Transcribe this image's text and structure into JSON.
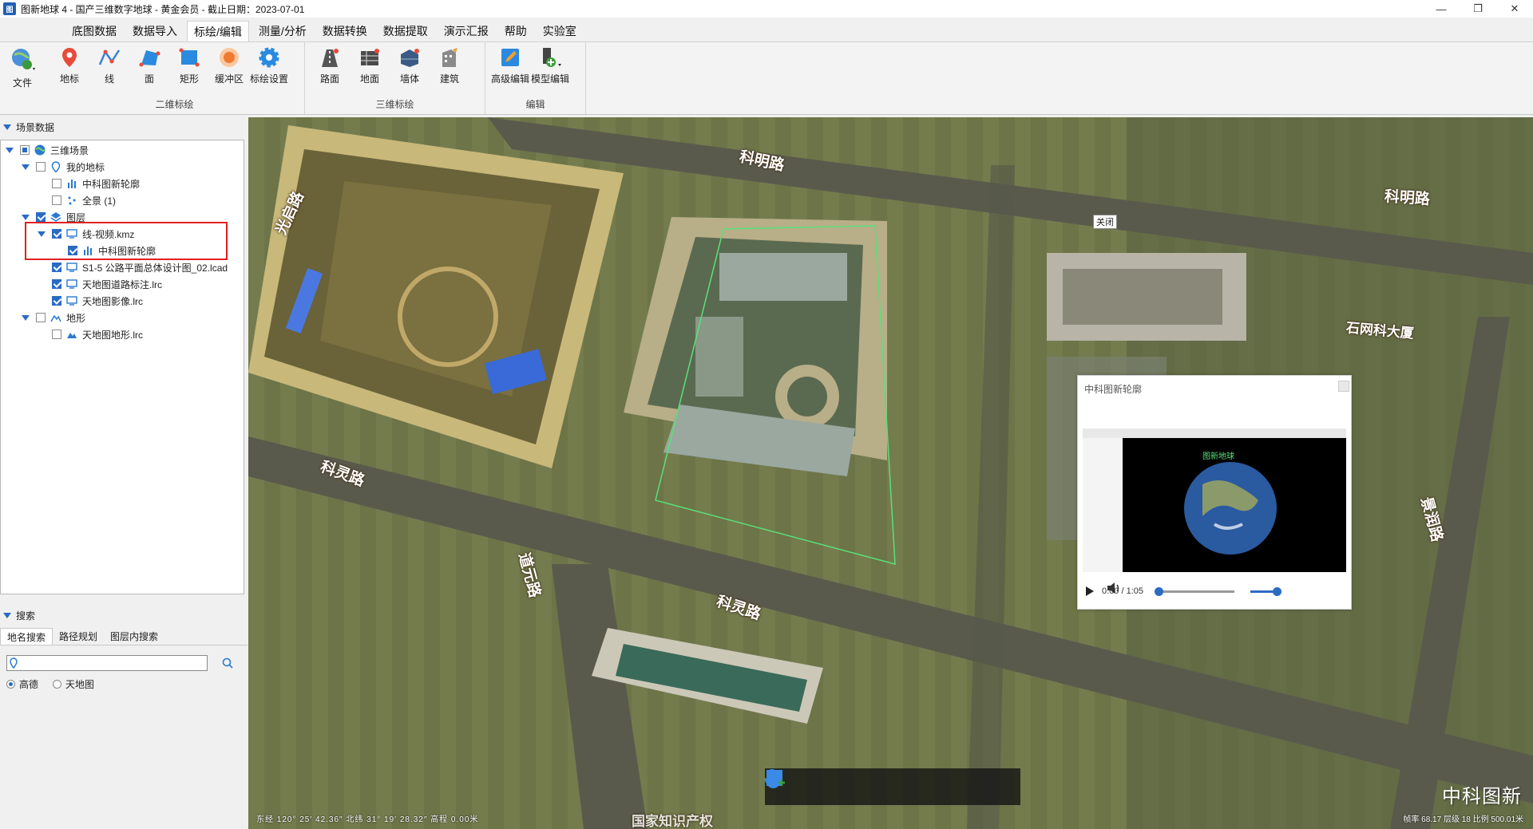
{
  "window": {
    "title": "图新地球 4 - 国产三维数字地球 - 黄金会员 - 截止日期：2023-07-01",
    "app_icon": "图",
    "controls": {
      "min": "—",
      "max": "❐",
      "close": "✕"
    }
  },
  "menu": [
    "底图数据",
    "数据导入",
    "标绘/编辑",
    "测量/分析",
    "数据转换",
    "数据提取",
    "演示汇报",
    "帮助",
    "实验室"
  ],
  "ribbon": {
    "file_label": "文件",
    "groups": [
      {
        "title": "二维标绘",
        "buttons": [
          "地标",
          "线",
          "面",
          "矩形",
          "缓冲区",
          "标绘设置"
        ]
      },
      {
        "title": "三维标绘",
        "buttons": [
          "路面",
          "地面",
          "墙体",
          "建筑"
        ]
      },
      {
        "title": "编辑",
        "buttons": [
          "高级编辑",
          "模型编辑"
        ]
      }
    ]
  },
  "scene_panel": {
    "header": "场景数据",
    "tree": [
      {
        "label": "三维场景"
      },
      {
        "label": "我的地标"
      },
      {
        "label": "中科图新轮廓"
      },
      {
        "label": "全景 (1)"
      },
      {
        "label": "图层"
      },
      {
        "label": "线-视频.kmz"
      },
      {
        "label": "中科图新轮廓"
      },
      {
        "label": "S1-5 公路平面总体设计图_02.lcad"
      },
      {
        "label": "天地图道路标注.lrc"
      },
      {
        "label": "天地图影像.lrc"
      },
      {
        "label": "地形"
      },
      {
        "label": "天地图地形.lrc"
      }
    ]
  },
  "search_panel": {
    "header": "搜索",
    "tabs": [
      "地名搜索",
      "路径规划",
      "图层内搜索"
    ],
    "input_value": "",
    "radios": [
      "高德",
      "天地图"
    ]
  },
  "map": {
    "road_labels": [
      "科明路",
      "科明路",
      "光启路",
      "科灵路",
      "科灵路",
      "道元路",
      "景润路",
      "石网科大厦",
      "国家知识产权"
    ],
    "close_tag": "关闭",
    "popup": {
      "title": "中科图新轮廓",
      "time": "0:00 / 1:05",
      "video_caption": "图新地球"
    },
    "watermark": "中科图新",
    "status_left": "东经 120° 25′ 42.36″  北纬 31° 19′ 28.32″  高程 0.00米",
    "status_right": "帧率 68.17  层级 18  比例 500.01米"
  }
}
